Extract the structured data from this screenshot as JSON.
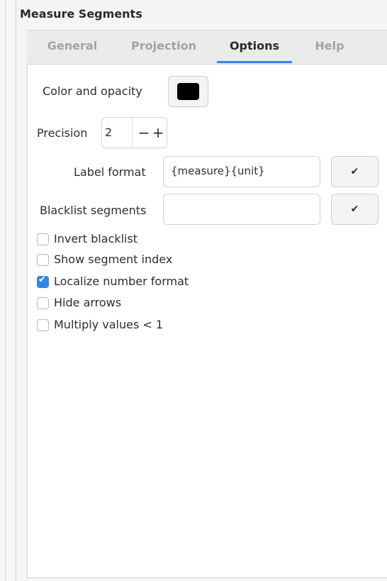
{
  "panel": {
    "title": "Measure Segments"
  },
  "tabs": [
    {
      "label": "General",
      "active": false
    },
    {
      "label": "Projection",
      "active": false
    },
    {
      "label": "Options",
      "active": true
    },
    {
      "label": "Help",
      "active": false
    }
  ],
  "options": {
    "color_label": "Color and opacity",
    "color_value": "#000000",
    "precision_label": "Precision",
    "precision_value": "2",
    "decrement_symbol": "−",
    "increment_symbol": "+",
    "label_format_label": "Label format",
    "label_format_value": "{measure}{unit}",
    "blacklist_label": "Blacklist segments",
    "blacklist_value": "",
    "apply_symbol": "✔"
  },
  "checkboxes": [
    {
      "label": "Invert blacklist",
      "checked": false
    },
    {
      "label": "Show segment index",
      "checked": false
    },
    {
      "label": "Localize number format",
      "checked": true
    },
    {
      "label": "Hide arrows",
      "checked": false
    },
    {
      "label": "Multiply values < 1",
      "checked": false
    }
  ],
  "colors": {
    "accent": "#3584e4",
    "checkbox_checked": "#3584e4"
  }
}
